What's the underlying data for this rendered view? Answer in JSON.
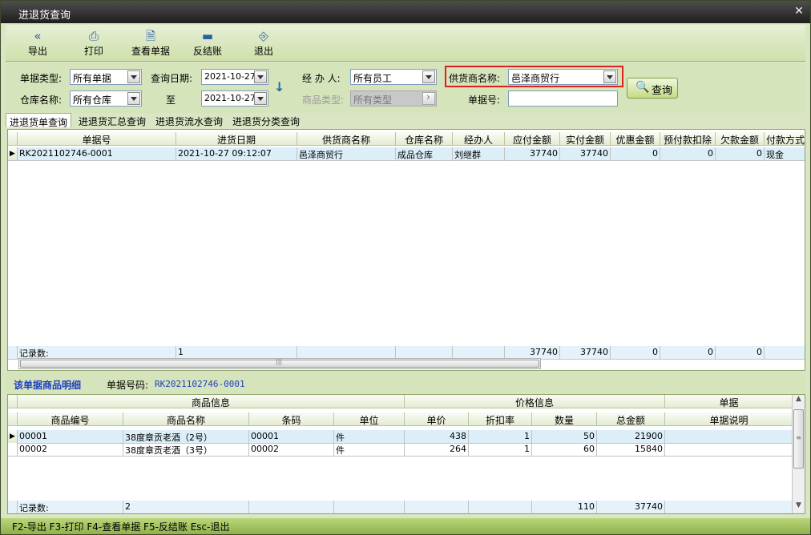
{
  "window": {
    "title": "进退货查询",
    "close_icon": "close-icon"
  },
  "toolbar": [
    {
      "label": "导出",
      "icon": "double-chevron-left-icon"
    },
    {
      "label": "打印",
      "icon": "printer-icon"
    },
    {
      "label": "查看单据",
      "icon": "document-search-icon"
    },
    {
      "label": "反结账",
      "icon": "minus-icon"
    },
    {
      "label": "退出",
      "icon": "exit-door-icon"
    }
  ],
  "filters": {
    "doc_type_label": "单据类型:",
    "doc_type_value": "所有单据",
    "warehouse_label": "仓库名称:",
    "warehouse_value": "所有仓库",
    "query_date_label": "查询日期:",
    "date_from": "2021-10-27",
    "to_label": "至",
    "date_to": "2021-10-27",
    "handler_label": "经 办 人:",
    "handler_value": "所有员工",
    "product_type_label": "商品类型:",
    "product_type_value": "所有类型",
    "supplier_label": "供货商名称:",
    "supplier_value": "邑泽商贸行",
    "doc_no_label": "单据号:",
    "doc_no_value": "",
    "query_button": "查询"
  },
  "tabs": [
    "进退货单查询",
    "进退货汇总查询",
    "进退货流水查询",
    "进退货分类查询"
  ],
  "main_table": {
    "headers": [
      "单据号",
      "进货日期",
      "供货商名称",
      "仓库名称",
      "经办人",
      "应付金额",
      "实付金额",
      "优惠金额",
      "预付款扣除",
      "欠款金额",
      "付款方式"
    ],
    "rows": [
      [
        "RK2021102746-0001",
        "2021-10-27 09:12:07",
        "邑泽商贸行",
        "成品仓库",
        "刘继群",
        "37740",
        "37740",
        "0",
        "0",
        "0",
        "现金"
      ]
    ],
    "footer": [
      "记录数:",
      "1",
      "",
      "",
      "",
      "37740",
      "37740",
      "0",
      "0",
      "0",
      ""
    ]
  },
  "detail": {
    "title": "该单据商品明细",
    "code_label": "单据号码:",
    "code_value": "RK2021102746-0001",
    "group_headers": [
      "商品信息",
      "价格信息",
      "单据"
    ],
    "headers": [
      "商品编号",
      "商品名称",
      "条码",
      "单位",
      "单价",
      "折扣率",
      "数量",
      "总金额",
      "单据说明"
    ],
    "rows": [
      [
        "00001",
        "38度章贡老酒（2号）",
        "00001",
        "件",
        "438",
        "1",
        "50",
        "21900",
        ""
      ],
      [
        "00002",
        "38度章贡老酒（3号）",
        "00002",
        "件",
        "264",
        "1",
        "60",
        "15840",
        ""
      ]
    ],
    "footer": [
      "记录数:",
      "2",
      "",
      "",
      "",
      "",
      "110",
      "37740",
      ""
    ]
  },
  "statusbar": "F2-导出 F3-打印 F4-查看单据 F5-反结账 Esc-退出"
}
